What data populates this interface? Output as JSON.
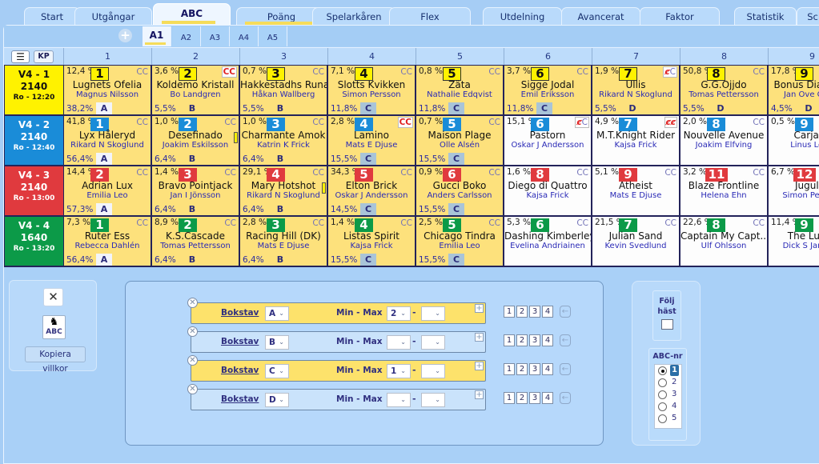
{
  "tabs": [
    {
      "label": "Start",
      "active": false,
      "underline": false
    },
    {
      "label": "Utgångar",
      "active": false,
      "underline": false
    },
    {
      "label": "ABC",
      "active": true,
      "underline": true
    },
    {
      "label": "Poäng",
      "active": false,
      "underline": true
    },
    {
      "label": "Spelarkåren",
      "active": false,
      "underline": false
    },
    {
      "label": "Flex",
      "active": false,
      "underline": false
    },
    {
      "label": "Utdelning",
      "active": false,
      "underline": false
    },
    {
      "label": "Avancerat",
      "active": false,
      "underline": false
    },
    {
      "label": "Faktor",
      "active": false,
      "underline": false
    },
    {
      "label": "Statistik",
      "active": false,
      "underline": false
    },
    {
      "label": "Sc",
      "active": false,
      "underline": false
    }
  ],
  "subtabs": [
    {
      "label": "A1",
      "active": true
    },
    {
      "label": "A2",
      "active": false
    },
    {
      "label": "A3",
      "active": false
    },
    {
      "label": "A4",
      "active": false
    },
    {
      "label": "A5",
      "active": false
    }
  ],
  "header": {
    "menu_icon": "hamburger-icon",
    "kp_label": "KP",
    "columns": [
      "1",
      "2",
      "3",
      "4",
      "5",
      "6",
      "7",
      "8",
      "9"
    ]
  },
  "races": [
    {
      "label": "V4 - 1",
      "distance": "2140",
      "time": "Ro - 12:20",
      "color": "#fff200",
      "text_color": "#111111",
      "cells": [
        {
          "pct": "12,4 %",
          "num": "1",
          "num_style": "yellow",
          "cc": "CC",
          "cc_style": "normal",
          "horse": "Lugnets Ofelia",
          "driver": "Magnus Nilsson",
          "odds": "38,2%",
          "abc": "A",
          "bg": "yellow"
        },
        {
          "pct": "3,6 %",
          "num": "2",
          "num_style": "yellow",
          "cc": "CC",
          "cc_style": "red",
          "horse": "Koldemo Kristall",
          "driver": "Bo Landgren",
          "odds": "5,5%",
          "abc": "B",
          "bg": "yellow"
        },
        {
          "pct": "0,7 %",
          "num": "3",
          "num_style": "yellow",
          "cc": "CC",
          "cc_style": "normal",
          "horse": "Hakkestadhs Runa",
          "driver": "Håkan Wallberg",
          "odds": "5,5%",
          "abc": "B",
          "bg": "yellow"
        },
        {
          "pct": "7,1 %",
          "num": "4",
          "num_style": "yellow",
          "cc": "CC",
          "cc_style": "normal",
          "horse": "Slotts Kvikken",
          "driver": "Simon Persson",
          "odds": "11,8%",
          "abc": "C",
          "bg": "yellow"
        },
        {
          "pct": "0,8 %",
          "num": "5",
          "num_style": "yellow",
          "cc": "CC",
          "cc_style": "normal",
          "horse": "Zäta",
          "driver": "Nathalie Edqvist",
          "odds": "11,8%",
          "abc": "C",
          "bg": "yellow"
        },
        {
          "pct": "3,7 %",
          "num": "6",
          "num_style": "yellow",
          "cc": "CC",
          "cc_style": "normal",
          "horse": "Sigge Jodal",
          "driver": "Emil Eriksson",
          "odds": "11,8%",
          "abc": "C",
          "bg": "yellow"
        },
        {
          "pct": "1,9 %",
          "num": "7",
          "num_style": "yellow",
          "cc": "¢C",
          "cc_style": "strike1",
          "horse": "Ullis",
          "driver": "Rikard N Skoglund",
          "odds": "5,5%",
          "abc": "D",
          "bg": "yellow"
        },
        {
          "pct": "50,8 %",
          "num": "8",
          "num_style": "yellow",
          "cc": "CC",
          "cc_style": "normal",
          "horse": "G.G.Ojjdo",
          "driver": "Tomas Pettersson",
          "odds": "5,5%",
          "abc": "D",
          "bg": "yellow"
        },
        {
          "pct": "17,8 %",
          "num": "9",
          "num_style": "yellow",
          "cc": "CC",
          "cc_style": "normal",
          "horse": "Bonus Diamond",
          "driver": "Jan Ove Olsen",
          "odds": "4,5%",
          "abc": "D",
          "bg": "yellow"
        }
      ]
    },
    {
      "label": "V4 - 2",
      "distance": "2140",
      "time": "Ro - 12:40",
      "color": "#1a8cd8",
      "text_color": "#ffffff",
      "cells": [
        {
          "pct": "41,8 %",
          "num": "1",
          "num_style": "blue",
          "cc": "CC",
          "cc_style": "normal",
          "horse": "Lyx Håleryd",
          "driver": "Rikard N Skoglund",
          "odds": "56,4%",
          "abc": "A",
          "bg": "yellow"
        },
        {
          "pct": "1,0 %",
          "num": "2",
          "num_style": "blue",
          "cc": "CC",
          "cc_style": "normal",
          "horse": "Desefinado",
          "driver": "Joakim Eskilsson",
          "odds": "6,4%",
          "abc": "B",
          "bg": "yellow",
          "flag": true
        },
        {
          "pct": "1,0 %",
          "num": "3",
          "num_style": "blue",
          "cc": "CC",
          "cc_style": "normal",
          "horse": "Charmante Amok",
          "driver": "Katrin K Frick",
          "odds": "6,4%",
          "abc": "B",
          "bg": "yellow"
        },
        {
          "pct": "2,8 %",
          "num": "4",
          "num_style": "blue",
          "cc": "CC",
          "cc_style": "red",
          "horse": "Lamino",
          "driver": "Mats E Djuse",
          "odds": "15,5%",
          "abc": "C",
          "bg": "yellow"
        },
        {
          "pct": "0,7 %",
          "num": "5",
          "num_style": "blue",
          "cc": "CC",
          "cc_style": "normal",
          "horse": "Maison Plage",
          "driver": "Olle Alsén",
          "odds": "15,5%",
          "abc": "C",
          "bg": "yellow"
        },
        {
          "pct": "15,1 %",
          "num": "6",
          "num_style": "blue",
          "cc": "¢C",
          "cc_style": "strike1",
          "horse": "Pastorn",
          "driver": "Oskar J Andersson",
          "odds": "",
          "abc": "",
          "bg": "white"
        },
        {
          "pct": "4,9 %",
          "num": "7",
          "num_style": "blue",
          "cc": "¢¢",
          "cc_style": "strike2",
          "horse": "M.T.Knight Rider",
          "driver": "Kajsa Frick",
          "odds": "",
          "abc": "",
          "bg": "white"
        },
        {
          "pct": "2,0 %",
          "num": "8",
          "num_style": "blue",
          "cc": "CC",
          "cc_style": "normal",
          "horse": "Nouvelle Avenue",
          "driver": "Joakim Elfving",
          "odds": "",
          "abc": "",
          "bg": "white"
        },
        {
          "pct": "0,5 %",
          "num": "9",
          "num_style": "blue",
          "cc": "CC",
          "cc_style": "normal",
          "horse": "Carjack",
          "driver": "Linus Lönn",
          "odds": "",
          "abc": "",
          "bg": "white"
        }
      ]
    },
    {
      "label": "V4 - 3",
      "distance": "2140",
      "time": "Ro - 13:00",
      "color": "#e03a3e",
      "text_color": "#ffffff",
      "cells": [
        {
          "pct": "14,4 %",
          "num": "2",
          "num_style": "red",
          "cc": "CC",
          "cc_style": "normal",
          "horse": "Adrian Lux",
          "driver": "Emilia Leo",
          "odds": "57,3%",
          "abc": "A",
          "bg": "yellow"
        },
        {
          "pct": "1,4 %",
          "num": "3",
          "num_style": "red",
          "cc": "CC",
          "cc_style": "normal",
          "horse": "Bravo Pointjack",
          "driver": "Jan I Jönsson",
          "odds": "6,4%",
          "abc": "B",
          "bg": "yellow"
        },
        {
          "pct": "29,1 %",
          "num": "4",
          "num_style": "red",
          "cc": "CC",
          "cc_style": "normal",
          "horse": "Mary Hotshot",
          "driver": "Rikard N Skoglund",
          "odds": "6,4%",
          "abc": "B",
          "bg": "yellow",
          "flag": true
        },
        {
          "pct": "34,3 %",
          "num": "5",
          "num_style": "red",
          "cc": "CC",
          "cc_style": "normal",
          "horse": "Elton Brick",
          "driver": "Oskar J Andersson",
          "odds": "14,5%",
          "abc": "C",
          "bg": "yellow"
        },
        {
          "pct": "0,9 %",
          "num": "6",
          "num_style": "red",
          "cc": "CC",
          "cc_style": "normal",
          "horse": "Gucci Boko",
          "driver": "Anders Carlsson",
          "odds": "15,5%",
          "abc": "C",
          "bg": "yellow"
        },
        {
          "pct": "1,6 %",
          "num": "8",
          "num_style": "red",
          "cc": "CC",
          "cc_style": "normal",
          "horse": "Diego di Quattro",
          "driver": "Kajsa Frick",
          "odds": "",
          "abc": "",
          "bg": "white"
        },
        {
          "pct": "5,1 %",
          "num": "9",
          "num_style": "red",
          "cc": "CC",
          "cc_style": "normal",
          "horse": "Atheist",
          "driver": "Mats E Djuse",
          "odds": "",
          "abc": "",
          "bg": "white"
        },
        {
          "pct": "3,2 %",
          "num": "11",
          "num_style": "red",
          "cc": "CC",
          "cc_style": "normal",
          "horse": "Blaze Frontline",
          "driver": "Helena Ehn",
          "odds": "",
          "abc": "",
          "bg": "white"
        },
        {
          "pct": "6,7 %",
          "num": "12",
          "num_style": "red",
          "cc": "CC",
          "cc_style": "normal",
          "horse": "Jugular",
          "driver": "Simon Persson",
          "odds": "",
          "abc": "",
          "bg": "white"
        }
      ]
    },
    {
      "label": "V4 - 4",
      "distance": "1640",
      "time": "Ro - 13:20",
      "color": "#0c9a48",
      "text_color": "#ffffff",
      "cells": [
        {
          "pct": "7,3 %",
          "num": "1",
          "num_style": "green",
          "cc": "CC",
          "cc_style": "normal",
          "horse": "Ruter Ess",
          "driver": "Rebecca Dahlén",
          "odds": "56,4%",
          "abc": "A",
          "bg": "yellow"
        },
        {
          "pct": "8,9 %",
          "num": "2",
          "num_style": "green",
          "cc": "CC",
          "cc_style": "normal",
          "horse": "K.S.Cascade",
          "driver": "Tomas Pettersson",
          "odds": "6,4%",
          "abc": "B",
          "bg": "yellow"
        },
        {
          "pct": "2,8 %",
          "num": "3",
          "num_style": "green",
          "cc": "CC",
          "cc_style": "normal",
          "horse": "Racing Hill (DK)",
          "driver": "Mats E Djuse",
          "odds": "6,4%",
          "abc": "B",
          "bg": "yellow"
        },
        {
          "pct": "1,4 %",
          "num": "4",
          "num_style": "green",
          "cc": "CC",
          "cc_style": "normal",
          "horse": "Listas Spirit",
          "driver": "Kajsa Frick",
          "odds": "15,5%",
          "abc": "C",
          "bg": "yellow"
        },
        {
          "pct": "2,5 %",
          "num": "5",
          "num_style": "green",
          "cc": "CC",
          "cc_style": "normal",
          "horse": "Chicago Tindra",
          "driver": "Emilia Leo",
          "odds": "15,5%",
          "abc": "C",
          "bg": "yellow"
        },
        {
          "pct": "5,3 %",
          "num": "6",
          "num_style": "green",
          "cc": "CC",
          "cc_style": "normal",
          "horse": "Dashing Kimberley",
          "driver": "Evelina Andriainen",
          "odds": "",
          "abc": "",
          "bg": "white"
        },
        {
          "pct": "21,5 %",
          "num": "7",
          "num_style": "green",
          "cc": "CC",
          "cc_style": "normal",
          "horse": "Julian Sand",
          "driver": "Kevin Svedlund",
          "odds": "",
          "abc": "",
          "bg": "white"
        },
        {
          "pct": "22,6 %",
          "num": "8",
          "num_style": "green",
          "cc": "CC",
          "cc_style": "normal",
          "horse": "Captain My Capt...",
          "driver": "Ulf Ohlsson",
          "odds": "",
          "abc": "",
          "bg": "white"
        },
        {
          "pct": "11,4 %",
          "num": "9",
          "num_style": "green",
          "cc": "CC",
          "cc_style": "normal",
          "horse": "The Lucky",
          "driver": "Dick S Jansson",
          "odds": "",
          "abc": "",
          "bg": "white"
        }
      ]
    }
  ],
  "left_panel": {
    "close_label": "✕",
    "abc_label": "ABC",
    "copy_label": "Kopiera villkor"
  },
  "conditions": [
    {
      "label": "Bokstav",
      "letter": "A",
      "minmax_label": "Min - Max",
      "min": "2",
      "max": "",
      "style": "yellow"
    },
    {
      "label": "Bokstav",
      "letter": "B",
      "minmax_label": "Min - Max",
      "min": "",
      "max": "",
      "style": "blue"
    },
    {
      "label": "Bokstav",
      "letter": "C",
      "minmax_label": "Min - Max",
      "min": "1",
      "max": "",
      "style": "yellow"
    },
    {
      "label": "Bokstav",
      "letter": "D",
      "minmax_label": "Min - Max",
      "min": "",
      "max": "",
      "style": "blue"
    }
  ],
  "race_buttons": [
    "1",
    "2",
    "3",
    "4"
  ],
  "dash": "-",
  "right_panel": {
    "follow_label_1": "Följ",
    "follow_label_2": "häst",
    "follow_checked": false,
    "abcnr_label": "ABC-nr",
    "abcnr_options": [
      "1",
      "2",
      "3",
      "4",
      "5"
    ],
    "abcnr_selected": "1"
  }
}
